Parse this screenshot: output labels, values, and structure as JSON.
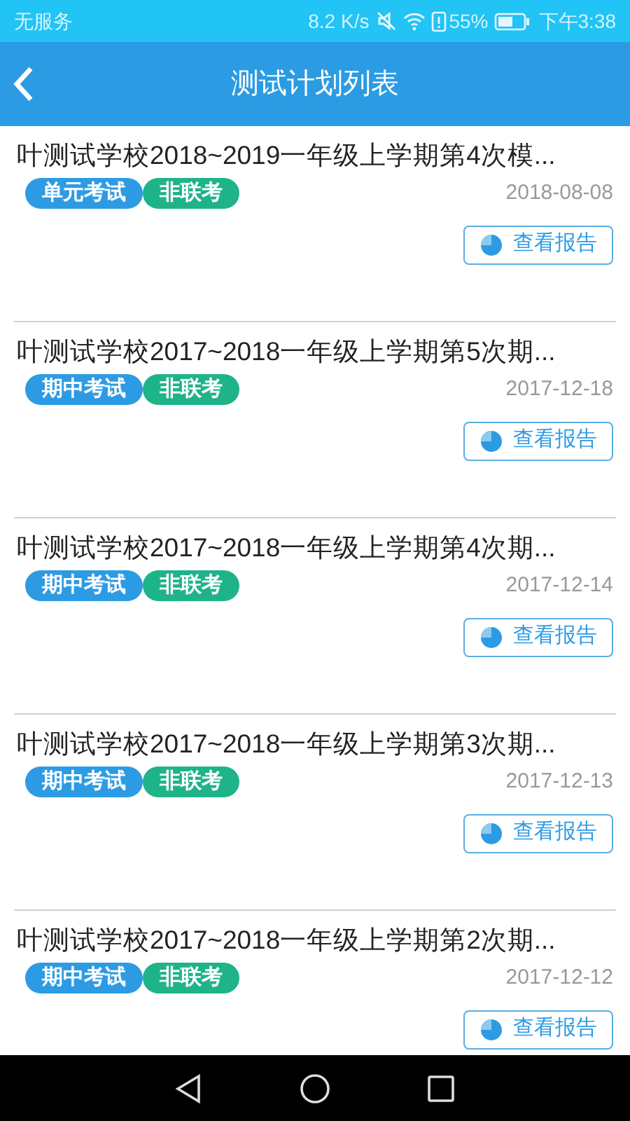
{
  "status_bar": {
    "carrier": "无服务",
    "speed": "8.2 K/s",
    "battery": "55%",
    "time": "下午3:38"
  },
  "header": {
    "title": "测试计划列表"
  },
  "plans": [
    {
      "title": "叶测试学校2018~2019一年级上学期第4次模...",
      "tags": [
        {
          "label": "单元考试",
          "color": "#2d9be3"
        },
        {
          "label": "非联考",
          "color": "#1fb38a"
        }
      ],
      "date": "2018-08-08",
      "button": "查看报告"
    },
    {
      "title": "叶测试学校2017~2018一年级上学期第5次期...",
      "tags": [
        {
          "label": "期中考试",
          "color": "#2d9be3"
        },
        {
          "label": "非联考",
          "color": "#1fb38a"
        }
      ],
      "date": "2017-12-18",
      "button": "查看报告"
    },
    {
      "title": "叶测试学校2017~2018一年级上学期第4次期...",
      "tags": [
        {
          "label": "期中考试",
          "color": "#2d9be3"
        },
        {
          "label": "非联考",
          "color": "#1fb38a"
        }
      ],
      "date": "2017-12-14",
      "button": "查看报告"
    },
    {
      "title": "叶测试学校2017~2018一年级上学期第3次期...",
      "tags": [
        {
          "label": "期中考试",
          "color": "#2d9be3"
        },
        {
          "label": "非联考",
          "color": "#1fb38a"
        }
      ],
      "date": "2017-12-13",
      "button": "查看报告"
    },
    {
      "title": "叶测试学校2017~2018一年级上学期第2次期...",
      "tags": [
        {
          "label": "期中考试",
          "color": "#2d9be3"
        },
        {
          "label": "非联考",
          "color": "#1fb38a"
        }
      ],
      "date": "2017-12-12",
      "button": "查看报告"
    }
  ]
}
